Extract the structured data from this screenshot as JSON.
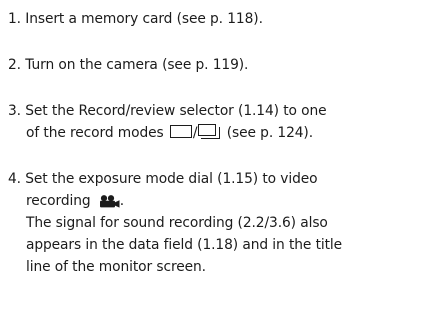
{
  "steps": [
    {
      "lines": [
        "1. Insert a memory card (see p. 118)."
      ]
    },
    {
      "lines": [
        "2. Turn on the camera (see p. 119)."
      ]
    },
    {
      "line1": "3. Set the Record/review selector (1.14) to one",
      "line2_before": "of the record modes ",
      "line2_sep": "/",
      "line2_after": " (see p. 124)."
    },
    {
      "line1": "4. Set the exposure mode dial (1.15) to video",
      "line2_before": "recording ",
      "line2_after": ".",
      "line3": "The signal for sound recording (2.2/3.6) also",
      "line4": "appears in the data field (1.18) and in the title",
      "line5": "line of the monitor screen."
    }
  ],
  "icons": {
    "single": "single-frame-mode-icon",
    "series": "continuous-series-mode-icon",
    "video": "video-recording-icon"
  }
}
